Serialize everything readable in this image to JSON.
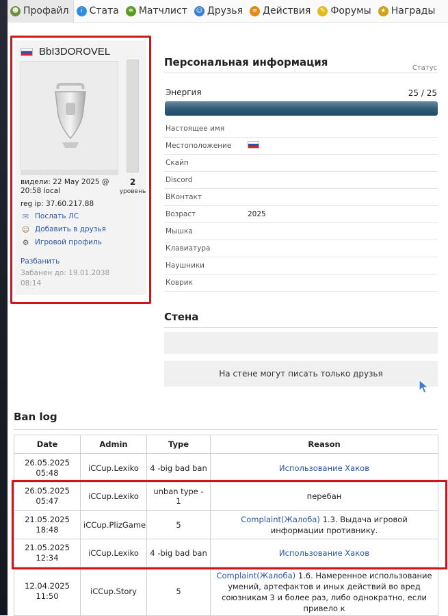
{
  "nav": {
    "items": [
      {
        "label": "Профайл",
        "icon": "profile-icon",
        "color": "#6f8f3a",
        "active": true
      },
      {
        "label": "Стата",
        "icon": "stats-icon",
        "color": "#2f8de4"
      },
      {
        "label": "Матчлист",
        "icon": "matchlist-icon",
        "color": "#5a9b23"
      },
      {
        "label": "Друзья",
        "icon": "friends-icon",
        "color": "#3b7fd4"
      },
      {
        "label": "Действия",
        "icon": "actions-icon",
        "color": "#e08a1e"
      },
      {
        "label": "Форумы",
        "icon": "forums-icon",
        "color": "#e0bb22"
      },
      {
        "label": "Награды",
        "icon": "awards-icon",
        "color": "#d4a017"
      }
    ]
  },
  "profile": {
    "username": "BbI3DOROVEL",
    "flag": "russia-flag-icon",
    "level": "2",
    "level_label": "уровень",
    "seen": "видели: 22 May 2025 @ 20:58 local",
    "reg_ip": "reg ip: 37.60.217.88",
    "actions": [
      {
        "label": "Послать ЛС",
        "icon": "mail-icon"
      },
      {
        "label": "Добавить в друзья",
        "icon": "add-friend-icon"
      },
      {
        "label": "Игровой профиль",
        "icon": "game-profile-icon"
      }
    ],
    "unban": "Разбанить",
    "banned_until": "Забанен до: 19.01.2038 08:14"
  },
  "personal": {
    "title": "Персональная информация",
    "status_label": "Статус",
    "energy_label": "Энергия",
    "energy_value": "25 / 25",
    "energy_fraction": 1.0,
    "fields": [
      {
        "key": "Настоящее имя",
        "value": ""
      },
      {
        "key": "Местоположение",
        "value": "",
        "flag": true
      },
      {
        "key": "Скайп",
        "value": ""
      },
      {
        "key": "Discord",
        "value": ""
      },
      {
        "key": "ВКонтакт",
        "value": ""
      },
      {
        "key": "Возраст",
        "value": "2025"
      },
      {
        "key": "Мышка",
        "value": ""
      },
      {
        "key": "Клавиатура",
        "value": ""
      },
      {
        "key": "Наушники",
        "value": ""
      },
      {
        "key": "Коврик",
        "value": ""
      }
    ]
  },
  "wall": {
    "title": "Стена",
    "message": "На стене могут писать только друзья"
  },
  "ban_log": {
    "title": "Ban log",
    "headers": [
      "Date",
      "Admin",
      "Type",
      "Reason"
    ],
    "rows": [
      {
        "date": "26.05.2025 05:48",
        "admin": "iCCup.Lexiko",
        "type": "4 -big bad ban",
        "reason_link": "Использование Хаков",
        "reason": ""
      },
      {
        "date": "26.05.2025 05:47",
        "admin": "iCCup.Lexiko",
        "type": "unban type - 1",
        "reason_link": "",
        "reason": "перебан"
      },
      {
        "date": "21.05.2025 18:48",
        "admin": "iCCup.PlizGame",
        "type": "5",
        "reason_link": "Complaint(Жалоба)",
        "reason": " 1.3. Выдача игровой информации противнику."
      },
      {
        "date": "21.05.2025 12:34",
        "admin": "iCCup.Lexiko",
        "type": "4 -big bad ban",
        "reason_link": "Использование Хаков",
        "reason": ""
      },
      {
        "date": "12.04.2025 11:50",
        "admin": "iCCup.Story",
        "type": "5",
        "reason_link": "Complaint(Жалоба)",
        "reason": " 1.6. Намеренное использование умений, артефактов и иных действий во вред союзникам 3 и более раз, либо однократно, если привело к"
      }
    ]
  }
}
